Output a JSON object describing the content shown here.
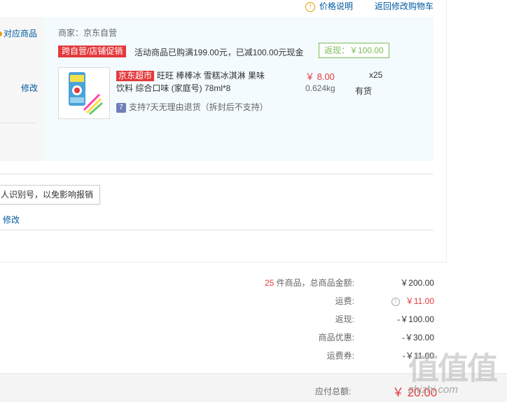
{
  "header": {
    "price_note": "价格说明",
    "back_to_cart": "返回修改购物车"
  },
  "left_col": {
    "option_label": "对应商品",
    "modify_1": "修改",
    "tooltip": "人识别号，以免影响报销",
    "modify_2": "修改"
  },
  "vendor": "商家：京东自营",
  "promo": {
    "tag": "跨自营/店铺促销",
    "text": "活动商品已购满199.00元，已减100.00元现金",
    "rebate": "返现：￥100.00"
  },
  "item": {
    "store_tag": "京东超市",
    "name_line1": "旺旺 棒棒冰 雪糕冰淇淋 果味",
    "name_line2": "饮料 综合口味 (家庭号) 78ml*8",
    "price": "￥ 8.00",
    "qty": "x25",
    "weight": "0.624kg",
    "stock": "有货",
    "return_icon": "7",
    "return_note": "支持7天无理由退货（拆封后不支持）"
  },
  "summary": {
    "count": "25",
    "count_suffix": " 件商品，总商品金额:",
    "goods_total": "￥200.00",
    "shipping_label": "运费:",
    "shipping_val": "￥11.00",
    "rebate_label": "返现:",
    "rebate_val": "-￥100.00",
    "discount_label": "商品优惠:",
    "discount_val": "-￥30.00",
    "coupon_label": "运费券:",
    "coupon_val": "-￥11.00",
    "payable_label": "应付总额:",
    "payable_val": "￥ 20.00"
  },
  "watermark": {
    "glyph": "值值值",
    "text": "zhizhi.com"
  },
  "colors": {
    "accent_red": "#e4393c",
    "link_blue": "#005aa0",
    "rebate_green": "#7abd54",
    "panel_blue": "#f3fbfe"
  }
}
